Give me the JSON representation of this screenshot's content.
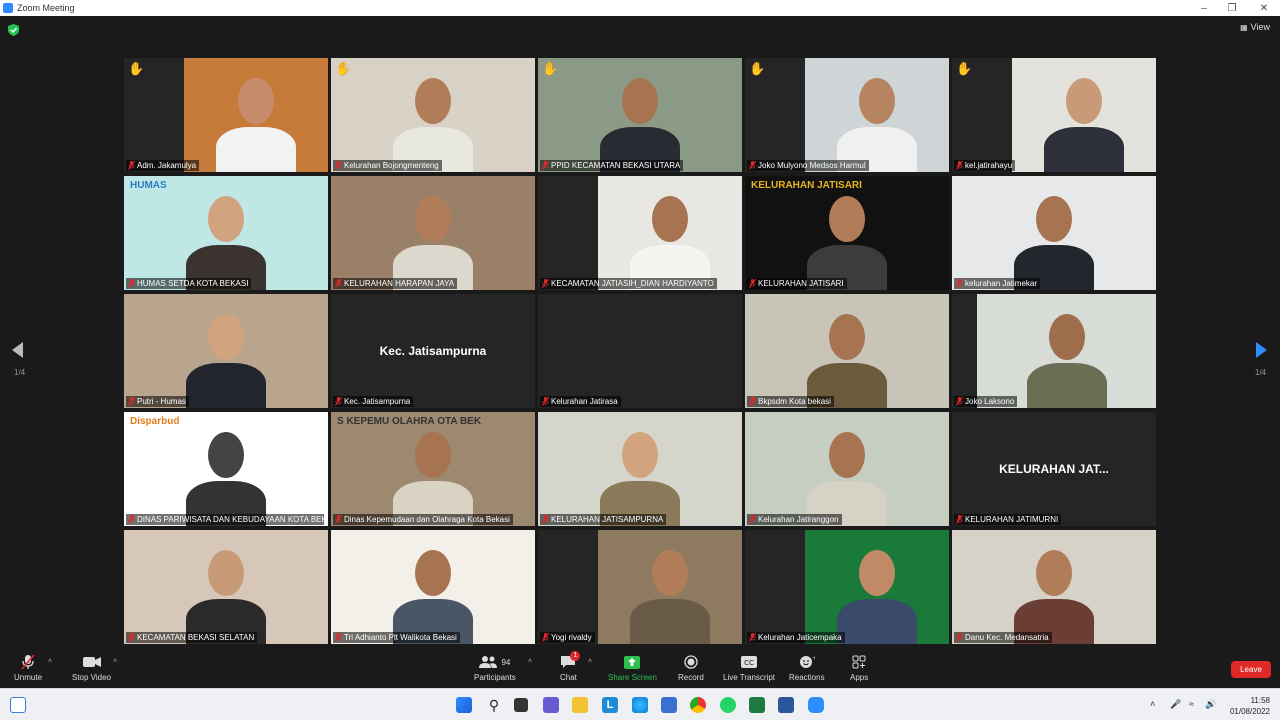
{
  "window": {
    "title": "Zoom Meeting"
  },
  "view": {
    "label": "View"
  },
  "pagination": {
    "left": "1/4",
    "right": "1/4"
  },
  "tiles": [
    {
      "name": "Adm. Jakamulya",
      "hand": true
    },
    {
      "name": "Kelurahan Bojongmenteng",
      "hand": true
    },
    {
      "name": "PPID KECAMATAN BEKASI UTARA",
      "hand": true
    },
    {
      "name": "Joko Mulyono Medsos Harmul",
      "hand": true
    },
    {
      "name": "kel.jatirahayu",
      "hand": true
    },
    {
      "name": "HUMAS SETDA KOTA BEKASI",
      "hand": false,
      "overlay": "HUMAS"
    },
    {
      "name": "KELURAHAN HARAPAN JAYA",
      "hand": false
    },
    {
      "name": "KECAMATAN JATIASIH_DIAN HARDIYANTO",
      "hand": false
    },
    {
      "name": "KELURAHAN JATISARI",
      "hand": false,
      "overlay": "KELURAHAN JATISARI"
    },
    {
      "name": "kelurahan Jatimekar",
      "hand": false
    },
    {
      "name": "Putri - Humas",
      "hand": false
    },
    {
      "name": "Kec. Jatisampurna",
      "hand": false,
      "display": "Kec. Jatisampurna"
    },
    {
      "name": "Kelurahan Jatirasa",
      "hand": false
    },
    {
      "name": "Bkpsdm Kota bekasi",
      "hand": false
    },
    {
      "name": "Joko Laksono",
      "hand": false
    },
    {
      "name": "DINAS PARIWISATA DAN KEBUDAYAAN KOTA BEKASI",
      "hand": false,
      "overlay": "Disparbud"
    },
    {
      "name": "Dinas Kepemudaan dan Olahraga Kota Bekasi",
      "hand": false,
      "overlay": "S KEPEMU OLAHRA OTA BEK"
    },
    {
      "name": "KELURAHAN JATISAMPURNA",
      "hand": false
    },
    {
      "name": "Kelurahan Jatiranggon",
      "hand": false
    },
    {
      "name": "KELURAHAN JATIMURNI",
      "hand": false,
      "display": "KELURAHAN  JAT..."
    },
    {
      "name": "KECAMATAN BEKASI SELATAN",
      "hand": false
    },
    {
      "name": "Tri Adhianto Plt Walikota Bekasi",
      "hand": false,
      "active": true
    },
    {
      "name": "Yogi rivaldy",
      "hand": false
    },
    {
      "name": "Kelurahan Jaticempaka",
      "hand": false
    },
    {
      "name": "Danu Kec. Medansatria",
      "hand": false
    }
  ],
  "toolbar": {
    "unmute": "Unmute",
    "stop_video": "Stop Video",
    "participants": "Participants",
    "participants_count": "94",
    "chat": "Chat",
    "chat_badge": "1",
    "share_screen": "Share Screen",
    "record": "Record",
    "live_transcript": "Live Transcript",
    "reactions": "Reactions",
    "apps": "Apps",
    "leave": "Leave"
  },
  "taskbar": {
    "time": "11:58",
    "date": "01/08/2022"
  },
  "colors": {
    "accent": "#2d8cff",
    "leave": "#e02828",
    "share": "#2fbf4f",
    "active_border": "#e0e36c"
  }
}
